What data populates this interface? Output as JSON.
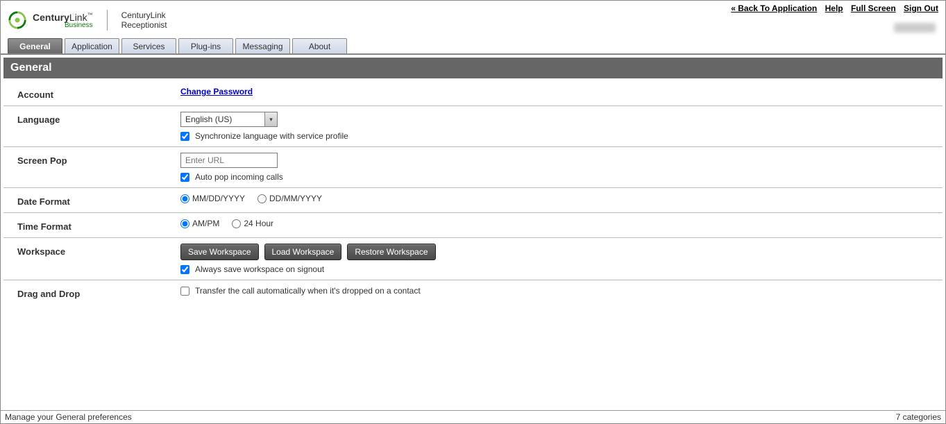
{
  "topLinks": {
    "back": "« Back To Application",
    "help": "Help",
    "fullscreen": "Full Screen",
    "signout": "Sign Out"
  },
  "branding": {
    "company_bold": "Century",
    "company_light": "Link",
    "tm": "™",
    "sub": "Business",
    "app_line1": "CenturyLink",
    "app_line2": "Receptionist"
  },
  "tabs": [
    "General",
    "Application",
    "Services",
    "Plug-ins",
    "Messaging",
    "About"
  ],
  "panelTitle": "General",
  "sections": {
    "account": {
      "label": "Account",
      "action": "Change Password"
    },
    "language": {
      "label": "Language",
      "selected": "English (US)",
      "sync": "Synchronize language with service profile",
      "syncChecked": true
    },
    "screenpop": {
      "label": "Screen Pop",
      "placeholder": "Enter URL",
      "autopop": "Auto pop incoming calls",
      "autopopChecked": true
    },
    "dateformat": {
      "label": "Date Format",
      "opt1": "MM/DD/YYYY",
      "opt2": "DD/MM/YYYY"
    },
    "timeformat": {
      "label": "Time Format",
      "opt1": "AM/PM",
      "opt2": "24 Hour"
    },
    "workspace": {
      "label": "Workspace",
      "save": "Save Workspace",
      "load": "Load Workspace",
      "restore": "Restore Workspace",
      "always": "Always save workspace on signout",
      "alwaysChecked": true
    },
    "dragdrop": {
      "label": "Drag and Drop",
      "transfer": "Transfer the call automatically when it's dropped on a contact",
      "transferChecked": false
    }
  },
  "footer": {
    "left": "Manage your General preferences",
    "right": "7 categories"
  }
}
